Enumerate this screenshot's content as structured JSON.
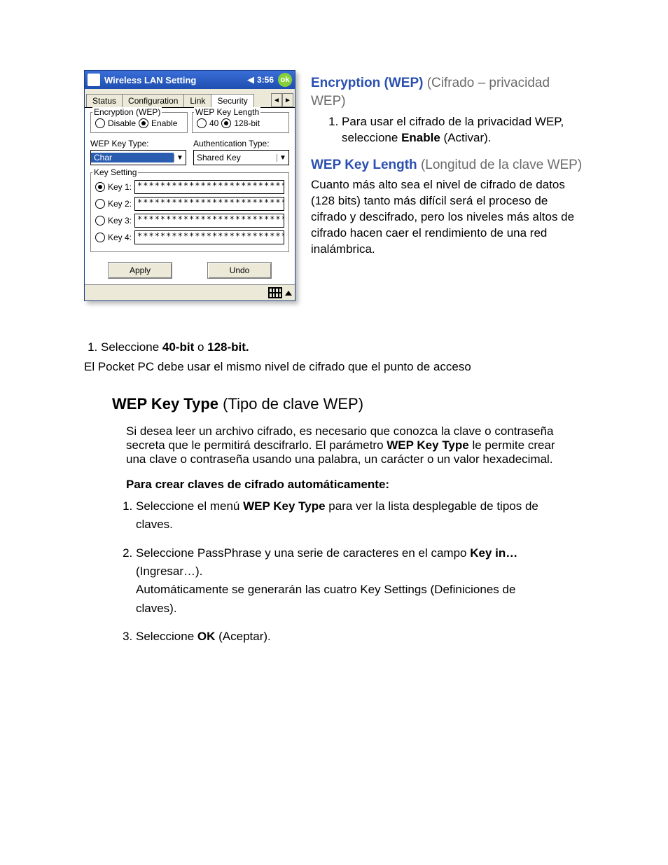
{
  "device": {
    "title": "Wireless LAN Setting",
    "clock": "3:56",
    "ok": "ok",
    "tabs": [
      "Status",
      "Configuration",
      "Link",
      "Security"
    ],
    "active_tab": "Security",
    "encryption": {
      "legend": "Encryption (WEP)",
      "disable": "Disable",
      "enable": "Enable"
    },
    "keylen": {
      "legend": "WEP Key Length",
      "opt40": "40",
      "opt128": "128-bit"
    },
    "keytype_label": "WEP Key Type:",
    "keytype_value": "Char",
    "auth_label": "Authentication Type:",
    "auth_value": "Shared Key",
    "keysetting_legend": "Key Setting",
    "keys": {
      "k1": "Key 1:",
      "k2": "Key 2:",
      "k3": "Key 3:",
      "k4": "Key 4:",
      "mask": "**************************"
    },
    "apply": "Apply",
    "undo": "Undo"
  },
  "right": {
    "enc_b": "Encryption (WEP) ",
    "enc_g": "(Cifrado – privacidad WEP)",
    "enc_step_a": "Para usar el cifrado de la privacidad WEP, seleccione ",
    "enc_step_b": "Enable",
    "enc_step_c": " (Activar).",
    "len_b": "WEP Key Length ",
    "len_g": "(Longitud de la clave WEP)",
    "len_para": "Cuanto más alto sea el nivel de cifrado de datos (128 bits) tanto más difícil será el proceso de cifrado y descifrado, pero los niveles más altos de cifrado hacen caer el rendimiento de una red inalámbrica."
  },
  "below": {
    "sel_a": "Seleccione ",
    "sel_b1": "40-bit",
    "sel_mid": " o ",
    "sel_b2": "128-bit.",
    "note": "El Pocket PC debe usar el mismo nivel de cifrado que el punto de acceso",
    "h3_b": "WEP Key Type",
    "h3_t": " (Tipo de clave WEP)",
    "desc_a": "Si desea leer un archivo cifrado, es necesario que conozca la clave o contraseña secreta que le permitirá descifrarlo. El parámetro ",
    "desc_b": "WEP Key Type",
    "desc_c": " le permite crear una clave o contraseña usando una palabra, un carácter o un valor hexadecimal.",
    "autohdr": "Para crear claves de cifrado automáticamente:",
    "s1a": "Seleccione el menú ",
    "s1b": "WEP Key Type",
    "s1c": " para ver la lista desplegable de tipos de claves.",
    "s2a": "Seleccione PassPhrase y una serie de caracteres en el campo ",
    "s2b": "Key in…",
    "s2c": " (Ingresar…).",
    "s2d": "Automáticamente se generarán las cuatro Key Settings (Definiciones de claves).",
    "s3a": "Seleccione ",
    "s3b": "OK",
    "s3c": " (Aceptar)."
  }
}
